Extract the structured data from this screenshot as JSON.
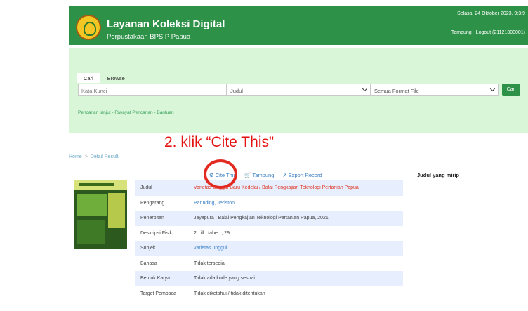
{
  "header": {
    "title": "Layanan Koleksi Digital",
    "subtitle": "Perpustakaan BPSIP Papua",
    "datetime": "Selasa, 24 Oktober 2023, 9:3:9",
    "tampung_label": "Tampung",
    "logout_label": "Logout (21121300001)"
  },
  "search": {
    "tabs": [
      "Cari",
      "Browse"
    ],
    "keyword_placeholder": "Kata Kunci",
    "field_selected": "Judul",
    "format_selected": "Semua Format File",
    "button_label": "Cari",
    "links": "Pencarian lanjut - Riwayat Pencarian - Bantuan"
  },
  "annotation": "2. klik “Cite This”",
  "breadcrumb": {
    "home": "Home",
    "separator": ">",
    "current": "Detail Result"
  },
  "actions": {
    "cite": "Cite This",
    "tampung": "Tampung",
    "export": "Export Record"
  },
  "similar_heading": "Judul yang mirip",
  "detail_rows": [
    {
      "label": "Judul",
      "value": "Varietas Unggul Baru Kedelai / Balai Pengkajian Teknologi Pertanian Papua",
      "style": "red"
    },
    {
      "label": "Pengarang",
      "value": "Parinding, Jeriston",
      "style": "link"
    },
    {
      "label": "Penerbitan",
      "value": "Jayapura : Balai Pengkajian Teknologi Pertanian Papua, 2021",
      "style": "plain"
    },
    {
      "label": "Deskripsi Fisik",
      "value": "2 : ill.; tabel. ; 29",
      "style": "plain"
    },
    {
      "label": "Subjek",
      "value": "varietas unggul",
      "style": "link"
    },
    {
      "label": "Bahasa",
      "value": "Tidak tersedia",
      "style": "plain"
    },
    {
      "label": "Bentuk Karya",
      "value": "Tidak ada kode yang sesuai",
      "style": "plain"
    },
    {
      "label": "Target Pembaca",
      "value": "Tidak diketahui / tidak ditentukan",
      "style": "plain"
    }
  ],
  "colors": {
    "header_green": "#2e9148",
    "panel_green": "#d9f6d9",
    "annotation_red": "#e3110f",
    "link_blue": "#3a7fc4"
  }
}
